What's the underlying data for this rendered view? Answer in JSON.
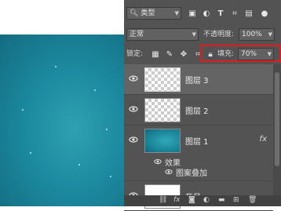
{
  "filter": {
    "label": "类型",
    "icons": [
      "image-filter-icon",
      "adjustment-filter-icon",
      "type-filter-icon",
      "shape-filter-icon",
      "smart-object-filter-icon",
      "pixel-filter-icon"
    ]
  },
  "blend": {
    "mode": "正常",
    "opacity_label": "不透明度:",
    "opacity_value": "100%"
  },
  "lock": {
    "label": "锁定:",
    "fill_label": "填充:",
    "fill_value": "70%"
  },
  "layers": [
    {
      "name": "图层 3",
      "selected": true,
      "thumb": "transparent"
    },
    {
      "name": "图层 2",
      "selected": false,
      "thumb": "transparent"
    },
    {
      "name": "图层 1",
      "selected": false,
      "thumb": "teal",
      "fx": "fx"
    },
    {
      "name": "背景",
      "selected": false,
      "thumb": "white"
    }
  ],
  "effects": {
    "title": "效果",
    "item": "图案叠加"
  },
  "bottom_icons": [
    "link-icon",
    "fx",
    "mask-icon",
    "adjustment-icon",
    "folder-icon",
    "new-layer-icon",
    "trash-icon"
  ],
  "colors": {
    "panel": "#535353",
    "highlight": "#e11b1b",
    "canvas": "#1c8aa0"
  }
}
